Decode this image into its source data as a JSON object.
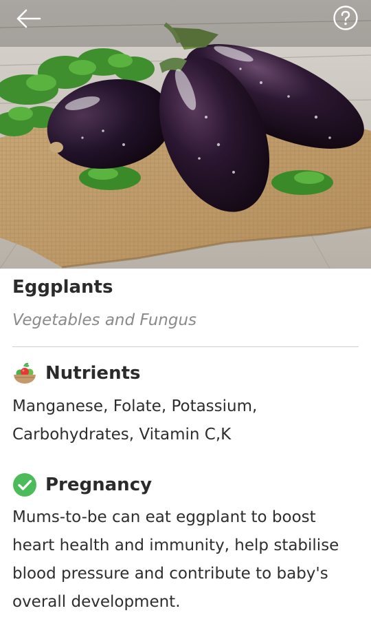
{
  "header": {
    "back_icon": "arrow-left-icon",
    "help_icon": "question-circle-icon"
  },
  "hero": {
    "subject": "eggplant-photo"
  },
  "food": {
    "title": "Eggplants",
    "category": "Vegetables and Fungus"
  },
  "nutrients": {
    "icon": "vegetable-basket-icon",
    "heading": "Nutrients",
    "text": "Manganese, Folate, Potassium, Carbohydrates, Vitamin C,K"
  },
  "pregnancy": {
    "icon": "check-circle-icon",
    "icon_color": "#4cbb5a",
    "heading": "Pregnancy",
    "text": "Mums-to-be can eat eggplant to boost heart health and immunity, help stabilise blood pressure and contribute to baby's overall development."
  }
}
